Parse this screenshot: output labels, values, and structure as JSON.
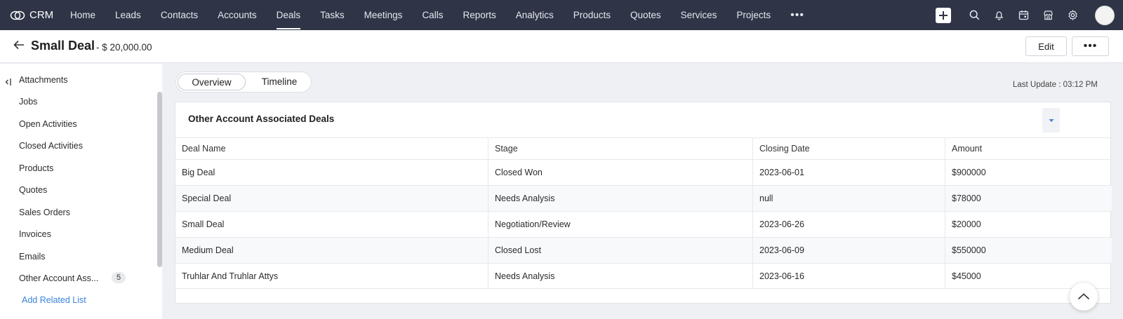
{
  "app": {
    "name": "CRM"
  },
  "nav": {
    "items": [
      {
        "label": "Home",
        "active": false
      },
      {
        "label": "Leads",
        "active": false
      },
      {
        "label": "Contacts",
        "active": false
      },
      {
        "label": "Accounts",
        "active": false
      },
      {
        "label": "Deals",
        "active": true
      },
      {
        "label": "Tasks",
        "active": false
      },
      {
        "label": "Meetings",
        "active": false
      },
      {
        "label": "Calls",
        "active": false
      },
      {
        "label": "Reports",
        "active": false
      },
      {
        "label": "Analytics",
        "active": false
      },
      {
        "label": "Products",
        "active": false
      },
      {
        "label": "Quotes",
        "active": false
      },
      {
        "label": "Services",
        "active": false
      },
      {
        "label": "Projects",
        "active": false
      }
    ],
    "more_label": "•••",
    "right_icons": [
      "plus-icon",
      "search-icon",
      "bell-icon",
      "calendar-icon",
      "marketplace-icon",
      "gear-icon"
    ]
  },
  "record": {
    "title": "Small Deal",
    "amount": "- $ 20,000.00",
    "edit_label": "Edit",
    "more_label": "•••"
  },
  "sidebar": {
    "items": [
      {
        "label": "Attachments"
      },
      {
        "label": "Jobs"
      },
      {
        "label": "Open Activities"
      },
      {
        "label": "Closed Activities"
      },
      {
        "label": "Products"
      },
      {
        "label": "Quotes"
      },
      {
        "label": "Sales Orders"
      },
      {
        "label": "Invoices"
      },
      {
        "label": "Emails"
      },
      {
        "label": "Other Account Ass...",
        "badge": "5"
      }
    ],
    "add_related": "Add Related List"
  },
  "tabs": {
    "overview": "Overview",
    "timeline": "Timeline"
  },
  "last_update": "Last Update : 03:12 PM",
  "card": {
    "title": "Other Account Associated Deals",
    "columns": [
      "Deal Name",
      "Stage",
      "Closing Date",
      "Amount"
    ],
    "rows": [
      [
        "Big Deal",
        "Closed Won",
        "2023-06-01",
        "$900000"
      ],
      [
        "Special Deal",
        "Needs Analysis",
        "null",
        "$78000"
      ],
      [
        "Small Deal",
        "Negotiation/Review",
        "2023-06-26",
        "$20000"
      ],
      [
        "Medium Deal",
        "Closed Lost",
        "2023-06-09",
        "$550000"
      ],
      [
        "Truhlar And Truhlar Attys",
        "Needs Analysis",
        "2023-06-16",
        "$45000"
      ]
    ]
  },
  "colors": {
    "topnav": "#2f3447",
    "link": "#3a83d8",
    "page_bg": "#eef0f3"
  }
}
